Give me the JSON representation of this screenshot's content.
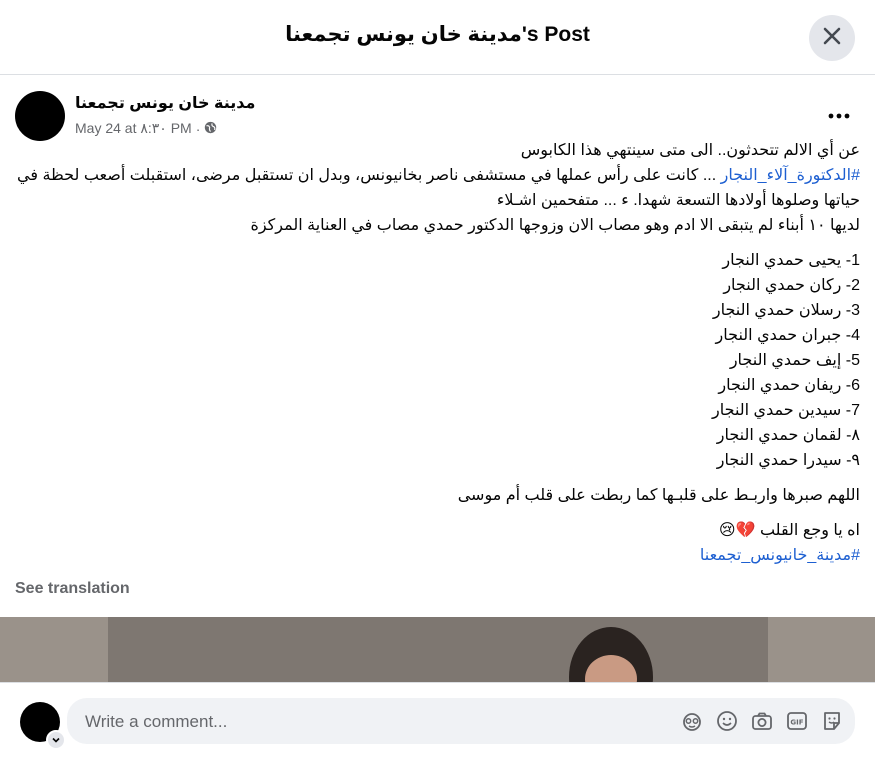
{
  "header": {
    "title": "مدينة خان يونس تجمعنا's Post",
    "close_icon": "close-icon"
  },
  "post": {
    "page_name": "مدينة خان يونس تجمعنا",
    "timestamp": "May 24 at ٨:٣٠ PM",
    "separator": "·",
    "audience_icon": "globe-icon",
    "more_icon": "more-dots-icon",
    "line1": "عن أي الالم تتحدثون.. الى متى سينتهي هذا الكابوس",
    "hashtag1": "#الدكتورة_آلاء_النجار",
    "line2_rest": " ... كانت على رأس عملها في مستشفى ناصر بخانيونس، وبدل ان تستقبل مرضى، استقبلت أصعب لحظة في حياتها وصلوها أولادها التسعة شهدا. ء ...  متفحمين اشـلاء",
    "line3": "لديها ١٠ أبناء لم يتبقى الا ادم وهو مصاب الان وزوجها الدكتور حمدي مصاب في العناية المركزة",
    "children": [
      "1- يحيى حمدي النجار",
      "2- ركان حمدي النجار",
      "3- رسلان حمدي النجار",
      "4- جبران حمدي النجار",
      "5- إيف حمدي النجار",
      "6- ريفان حمدي النجار",
      "7- سيدين حمدي النجار",
      "٨- لقمان حمدي النجار",
      "٩- سيدرا حمدي النجار"
    ],
    "prayer": "اللهم صبرها واربـط على قلبـها كما ربطت على قلب أم موسى",
    "heartache": "اه يا وجع القلب 💔😢",
    "hashtag2": "#مدينة_خانيونس_تجمعنا",
    "see_translation": "See translation"
  },
  "comment_bar": {
    "placeholder": "Write a comment...",
    "icons": [
      "avatar-sticker-icon",
      "emoji-icon",
      "camera-icon",
      "gif-icon",
      "sticker-icon"
    ]
  },
  "colors": {
    "hashtag": "#1d5fd1",
    "secondary_text": "#65676b",
    "input_bg": "#f0f2f5",
    "close_bg": "#e4e6eb"
  }
}
